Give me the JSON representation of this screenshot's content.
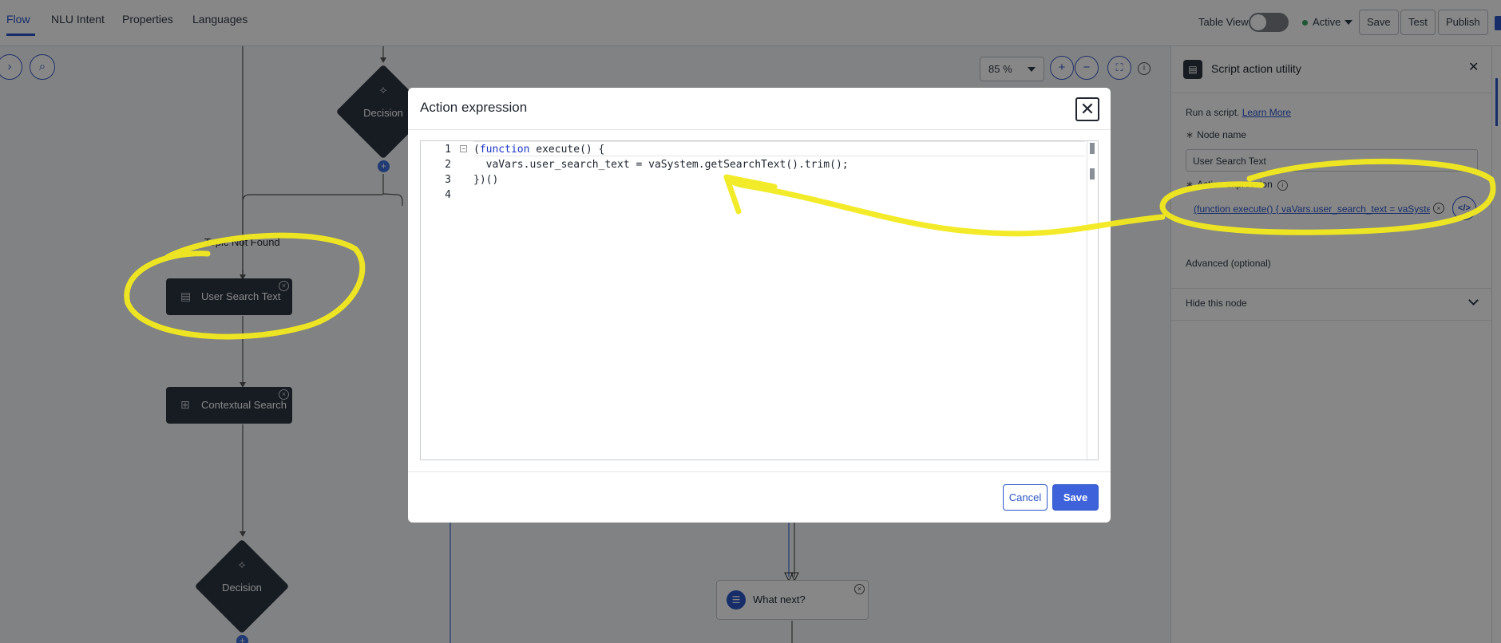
{
  "tabs": [
    {
      "label": "Flow"
    },
    {
      "label": "NLU Intent"
    },
    {
      "label": "Properties"
    },
    {
      "label": "Languages"
    }
  ],
  "header": {
    "table_view_label": "Table View",
    "status_label": "Active",
    "save_label": "Save",
    "test_label": "Test",
    "publish_label": "Publish"
  },
  "canvas": {
    "zoom_level": "85 %",
    "branch_label": "Topic Not Found",
    "nodes": {
      "decision_top": "Decision",
      "user_search_text": "User Search Text",
      "contextual_search": "Contextual Search",
      "decision_bottom": "Decision",
      "what_next": "What next?"
    }
  },
  "panel": {
    "title": "Script action utility",
    "description": "Run a script.",
    "learn_more": "Learn More",
    "node_name_label": "Node name",
    "node_name_value": "User Search Text",
    "action_expression_label": "Action expression",
    "action_expression_value": "(function execute() { vaVars.user_search_text = vaSyste",
    "advanced_label": "Advanced (optional)",
    "hide_node_label": "Hide this node"
  },
  "modal": {
    "title": "Action expression",
    "line_numbers": [
      "1",
      "2",
      "3",
      "4"
    ],
    "code": {
      "line1_paren": "(",
      "line1_kw": "function",
      "line1_rest": " execute() {",
      "line2": "  vaVars.user_search_text = vaSystem.getSearchText().trim();",
      "line3": "})()",
      "line4": ""
    },
    "cancel_label": "Cancel",
    "save_label": "Save"
  },
  "colors": {
    "accent": "#2c56c9",
    "node_dark": "#2d3540",
    "highlight_annotation": "#f2ea1e",
    "overlay": "rgba(0,0,0,0.47)"
  }
}
